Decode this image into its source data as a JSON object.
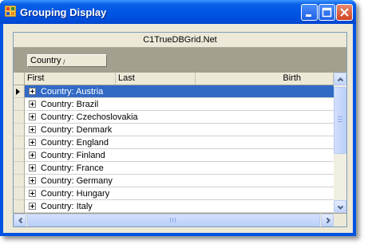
{
  "window": {
    "title": "Grouping Display"
  },
  "grid": {
    "caption": "C1TrueDBGrid.Net",
    "group_by": {
      "label": "Country",
      "sort_indicator": "/"
    },
    "columns": [
      "First",
      "Last",
      "Birth"
    ],
    "rows": [
      {
        "label": "Country: Austria",
        "selected": true
      },
      {
        "label": "Country: Brazil"
      },
      {
        "label": "Country: Czechoslovakia"
      },
      {
        "label": "Country: Denmark"
      },
      {
        "label": "Country: England"
      },
      {
        "label": "Country: Finland"
      },
      {
        "label": "Country: France"
      },
      {
        "label": "Country: Germany"
      },
      {
        "label": "Country: Hungary"
      },
      {
        "label": "Country: Italy"
      }
    ]
  },
  "icons": {
    "app": "app-window-icon",
    "minimize": "minimize-icon",
    "maximize": "maximize-icon",
    "close": "close-icon",
    "expand": "plus-expander-icon",
    "current_row": "row-pointer-icon"
  },
  "colors": {
    "selection": "#316ac5",
    "titlebar": "#0055e5",
    "group_area": "#a3a08f"
  }
}
